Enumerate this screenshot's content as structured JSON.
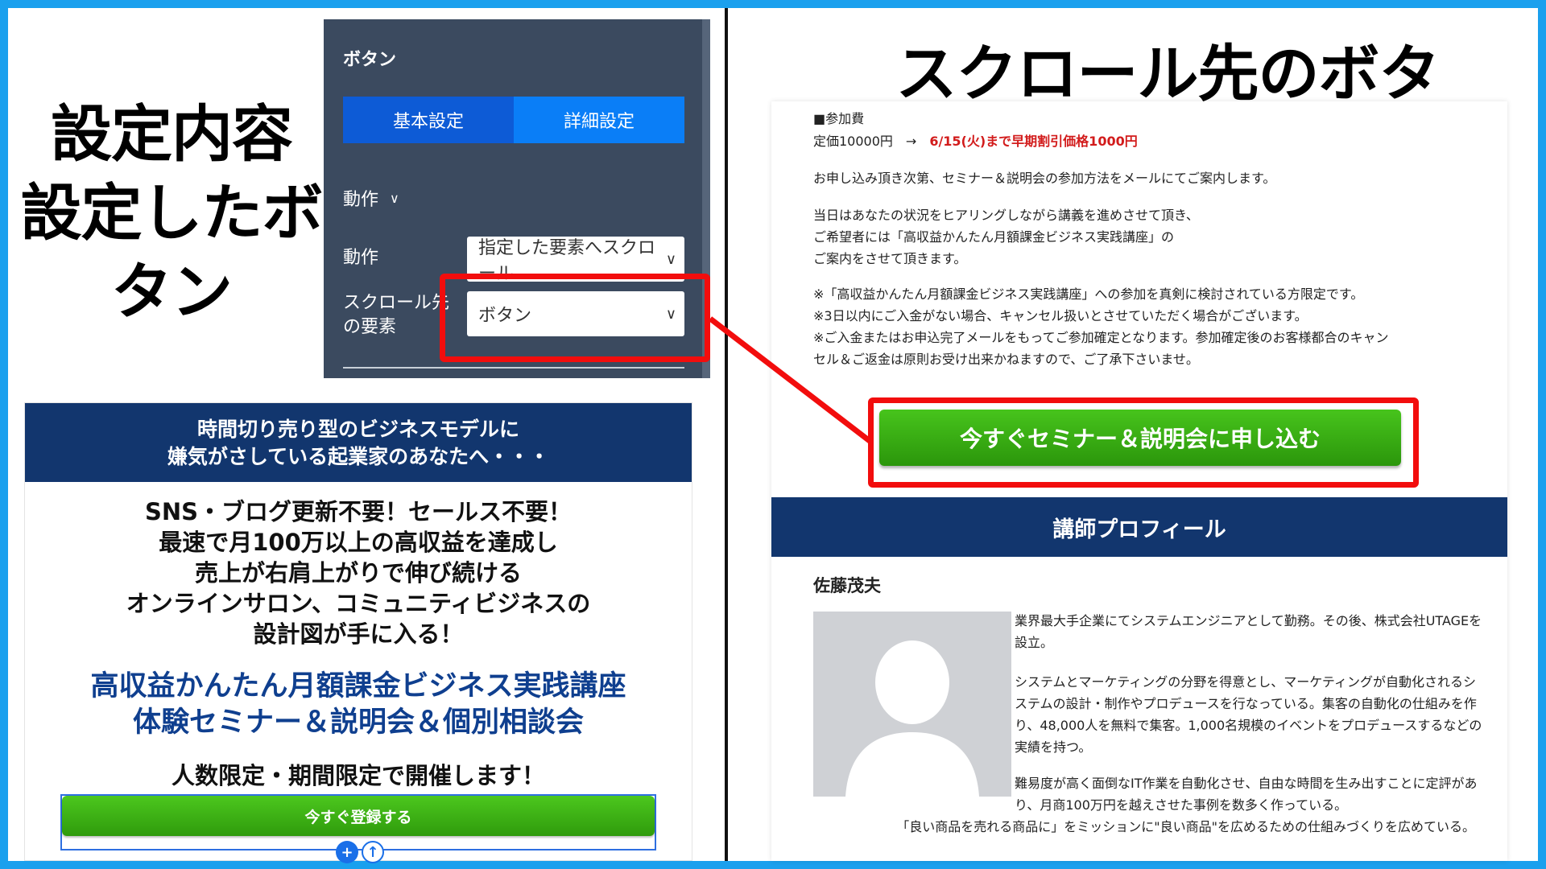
{
  "headings": {
    "left_line1": "設定内容",
    "left_line2": "設定したボタン",
    "right": "スクロール先のボタン"
  },
  "panel": {
    "title": "ボタン",
    "tabs": [
      {
        "label": "基本設定"
      },
      {
        "label": "詳細設定"
      }
    ],
    "section": "動作",
    "action_label": "動作",
    "action_value": "指定した要素へスクロール",
    "target_label_1": "スクロール先",
    "target_label_2": "の要素",
    "target_value": "ボタン"
  },
  "lp_left": {
    "band_line1": "時間切り売り型のビジネスモデルに",
    "band_line2": "嫌気がさしている起業家のあなたへ・・・",
    "copy": [
      "SNS・ブログ更新不要！セールス不要！",
      "最速で月100万以上の高収益を達成し",
      "売上が右肩上がりで伸び続ける",
      "オンラインサロン、コミュニティビジネスの",
      "設計図が手に入る！"
    ],
    "blue_line1": "高収益かんたん月額課金ビジネス実践講座",
    "blue_line2": "体験セミナー＆説明会＆個別相談会",
    "limit": "人数限定・期間限定で開催します！",
    "button": "今すぐ登録する",
    "ctrl_plus": "+",
    "ctrl_up": "↑"
  },
  "lp_right": {
    "fee_title": "■参加費",
    "fee_regular": "定価10000円　→　",
    "fee_early": "6/15(火)まで早期割引価格1000円",
    "p1": "お申し込み頂き次第、セミナー＆説明会の参加方法をメールにてご案内します。",
    "p2_1": "当日はあなたの状況をヒアリングしながら講義を進めさせて頂き、",
    "p2_2": "ご希望者には「高収益かんたん月額課金ビジネス実践講座」の",
    "p2_3": "ご案内をさせて頂きます。",
    "n1": "※「高収益かんたん月額課金ビジネス実践講座」への参加を真剣に検討されている方限定です。",
    "n2": "※3日以内にご入金がない場合、キャンセル扱いとさせていただく場合がございます。",
    "n3_1": "※ご入金またはお申込完了メールをもってご参加確定となります。参加確定後のお客様都合のキャン",
    "n3_2": "セル＆ご返金は原則お受け出来かねますので、ご了承下さいませ。",
    "cta": "今すぐセミナー＆説明会に申し込む",
    "profile_title": "講師プロフィール",
    "name": "佐藤茂夫",
    "bio1": "業界最大手企業にてシステムエンジニアとして勤務。その後、株式会社UTAGEを設立。",
    "bio2": "システムとマーケティングの分野を得意とし、マーケティングが自動化されるシステムの設計・制作やプロデュースを行なっている。集客の自動化の仕組みを作り、48,000人を無料で集客。1,000名規模のイベントをプロデュースするなどの実績を持つ。",
    "bio3": "難易度が高く面倒なIT作業を自動化させ、自由な時間を生み出すことに定評があり、月商100万円を越えさせた事例を数多く作っている。",
    "bio4": "「良い商品を売れる商品に」をミッションに\"良い商品\"を広めるための仕組みづくりを広めている。"
  },
  "colors": {
    "frame": "#1aa0ee",
    "navy": "#12366e",
    "red": "#f20d0d",
    "green": "#3fb316"
  },
  "icons": [
    "chevron-down-icon",
    "plus-icon",
    "arrow-up-icon",
    "avatar-silhouette-icon"
  ]
}
